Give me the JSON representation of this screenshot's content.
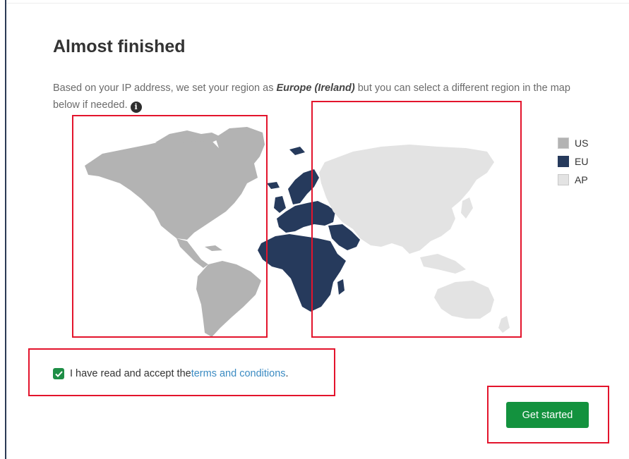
{
  "page": {
    "title": "Almost finished",
    "description_before": "Based on your IP address, we set your region as ",
    "detected_region": "Europe (Ireland)",
    "description_after": " but you can select a different region in the map below if needed.",
    "info_icon_glyph": "i"
  },
  "map": {
    "selected_region": "EU",
    "regions": [
      {
        "code": "US",
        "color": "#b3b3b3"
      },
      {
        "code": "EU",
        "color": "#263a5c"
      },
      {
        "code": "AP",
        "color": "#e3e3e3"
      }
    ]
  },
  "legend": {
    "items": [
      {
        "label": "US",
        "color": "#b3b3b3"
      },
      {
        "label": "EU",
        "color": "#263a5c"
      },
      {
        "label": "AP",
        "color": "#e3e3e3"
      }
    ]
  },
  "terms": {
    "checked": true,
    "prefix": "I have read and accept the ",
    "link_text": "terms and conditions",
    "suffix": "."
  },
  "actions": {
    "get_started_label": "Get started",
    "accent_color": "#13923e"
  }
}
